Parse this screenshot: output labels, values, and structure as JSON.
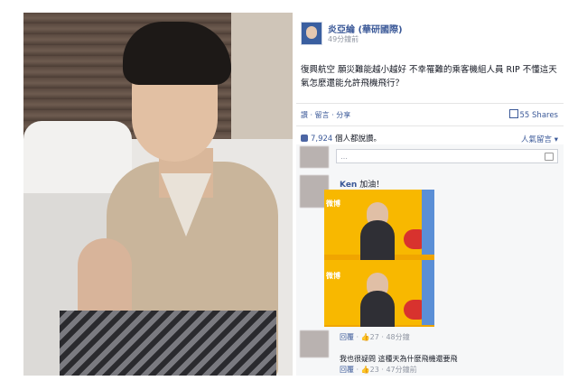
{
  "post": {
    "page_name": "炎亞綸 (華研國際)",
    "time": "49分鐘前",
    "text": "復興航空 願災難能越小越好 不幸罹難的乘客機組人員 RIP 不懂這天氣怎麼還能允許飛機飛行？"
  },
  "actions": {
    "text": "讚 · 留言 · 分享",
    "shares": "55 Shares"
  },
  "likes": {
    "count": "7,924",
    "suffix": "個人都說讚。",
    "sort": "人氣留言"
  },
  "comments": [
    {
      "name": "Ken",
      "text": "加油！",
      "image_logo": "微博",
      "reply_label": "回覆",
      "likes": "27",
      "time": "48分鐘"
    },
    {
      "text": "我也很疑問 這種天為什麼飛機還要飛",
      "reply_label": "回覆",
      "likes": "23",
      "time": "47分鐘前"
    }
  ]
}
